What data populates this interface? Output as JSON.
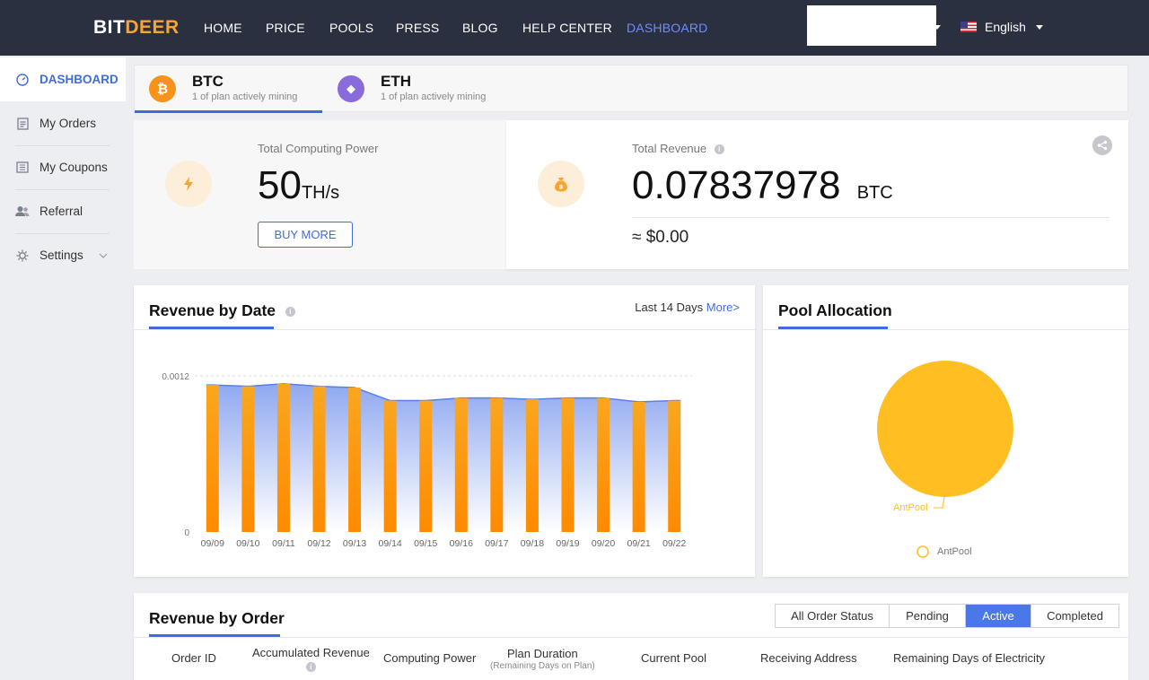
{
  "brand": {
    "part1": "BIT",
    "part2": "DEER"
  },
  "nav": {
    "items": [
      {
        "label": "HOME",
        "active": false
      },
      {
        "label": "PRICE",
        "active": false
      },
      {
        "label": "POOLS",
        "active": false
      },
      {
        "label": "PRESS",
        "active": false
      },
      {
        "label": "BLOG",
        "active": false
      },
      {
        "label": "HELP CENTER",
        "active": false
      },
      {
        "label": "DASHBOARD",
        "active": true
      }
    ],
    "language": "English"
  },
  "sidebar": {
    "items": [
      {
        "label": "DASHBOARD",
        "icon": "gauge-icon",
        "active": true
      },
      {
        "label": "My Orders",
        "icon": "document-icon",
        "active": false
      },
      {
        "label": "My Coupons",
        "icon": "ticket-icon",
        "active": false
      },
      {
        "label": "Referral",
        "icon": "users-icon",
        "active": false
      },
      {
        "label": "Settings",
        "icon": "gear-icon",
        "active": false
      }
    ]
  },
  "coins": [
    {
      "name": "BTC",
      "sub": "1 of plan actively mining",
      "symbol": "₿",
      "color": "#f7931a",
      "active": true
    },
    {
      "name": "ETH",
      "sub": "1 of plan actively mining",
      "symbol": "◆",
      "color": "#8a6bdc",
      "active": false
    }
  ],
  "power": {
    "label": "Total Computing Power",
    "value": "50",
    "unit": "TH/s",
    "buy_label": "BUY MORE"
  },
  "revenue": {
    "label": "Total Revenue",
    "value": "0.07837978",
    "unit": "BTC",
    "usd": "≈ $0.00"
  },
  "revenue_by_date": {
    "title": "Revenue by Date",
    "range_label": "Last 14 Days",
    "more_label": "More>"
  },
  "chart_data": {
    "type": "bar",
    "categories": [
      "09/09",
      "09/10",
      "09/11",
      "09/12",
      "09/13",
      "09/14",
      "09/15",
      "09/16",
      "09/17",
      "09/18",
      "09/19",
      "09/20",
      "09/21",
      "09/22"
    ],
    "series": [
      {
        "values": [
          0.00113,
          0.00112,
          0.00114,
          0.00112,
          0.00111,
          0.00101,
          0.00101,
          0.00103,
          0.00103,
          0.00102,
          0.00103,
          0.00103,
          0.001,
          0.00101
        ]
      }
    ],
    "y_ticks": [
      "0.0012",
      "0"
    ],
    "ylim": [
      0,
      0.0012
    ],
    "bar_color": "#f7931a",
    "area_color": "#8fa8f0"
  },
  "pool_allocation": {
    "title": "Pool Allocation",
    "chart": {
      "type": "pie",
      "slices": [
        {
          "label": "AntPool",
          "value": 100,
          "color": "#ffbe22"
        }
      ],
      "legend": "bottom"
    }
  },
  "revenue_by_order": {
    "title": "Revenue by Order",
    "statuses": [
      {
        "label": "All Order Status",
        "active": false
      },
      {
        "label": "Pending",
        "active": false
      },
      {
        "label": "Active",
        "active": true
      },
      {
        "label": "Completed",
        "active": false
      }
    ],
    "columns": [
      {
        "label": "Order ID",
        "sub": ""
      },
      {
        "label": "Accumulated Revenue",
        "sub": ""
      },
      {
        "label": "Computing Power",
        "sub": ""
      },
      {
        "label": "Plan Duration",
        "sub": "(Remaining Days on Plan)"
      },
      {
        "label": "Current Pool",
        "sub": ""
      },
      {
        "label": "Receiving Address",
        "sub": ""
      },
      {
        "label": "Remaining Days of Electricity",
        "sub": ""
      }
    ]
  }
}
